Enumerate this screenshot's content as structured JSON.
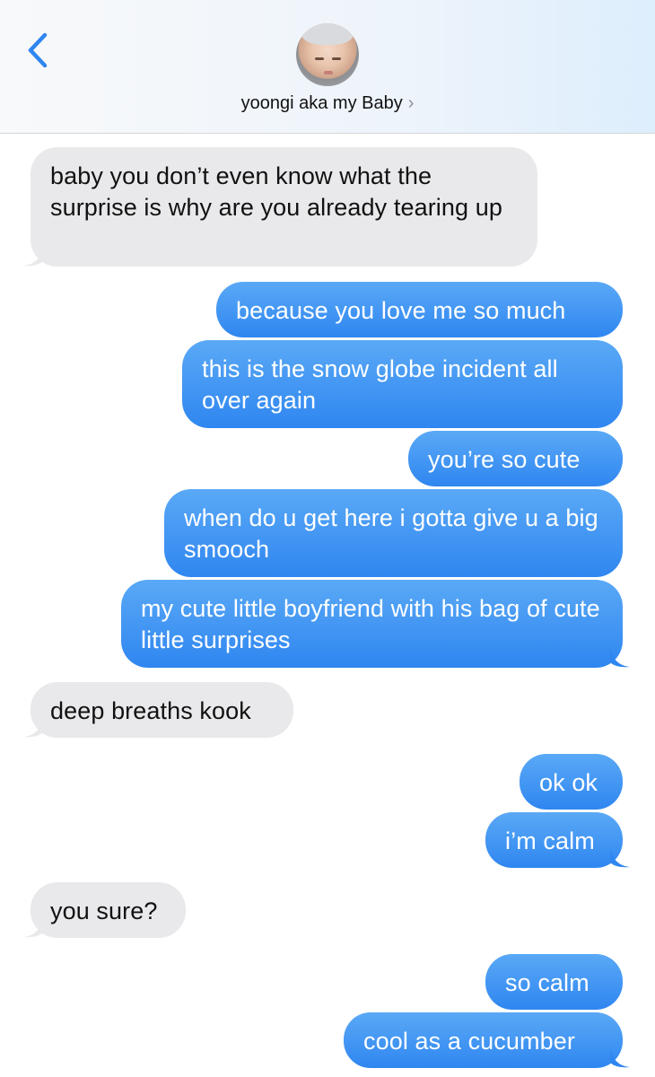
{
  "header": {
    "contact_name": "yoongi aka my Baby",
    "chevron": "›",
    "back_icon": "chevron-left-icon",
    "accent_color": "#2f86f0"
  },
  "messages": [
    {
      "direction": "received",
      "text": "baby you don’t even know what the surprise is why are you already tearing up"
    },
    {
      "direction": "sent",
      "text": "because you love me so much"
    },
    {
      "direction": "sent",
      "text": "this is the snow globe incident all over again"
    },
    {
      "direction": "sent",
      "text": "you’re so cute"
    },
    {
      "direction": "sent",
      "text": "when do u get here i gotta give u a big smooch"
    },
    {
      "direction": "sent",
      "text": "my cute little boyfriend with his bag of cute little surprises"
    },
    {
      "direction": "received",
      "text": "deep breaths kook"
    },
    {
      "direction": "sent",
      "text": "ok ok"
    },
    {
      "direction": "sent",
      "text": "i’m calm"
    },
    {
      "direction": "received",
      "text": "you sure?"
    },
    {
      "direction": "sent",
      "text": "so calm"
    },
    {
      "direction": "sent",
      "text": "cool as a cucumber"
    }
  ],
  "colors": {
    "sent_bubble": "#3a8ef2",
    "received_bubble": "#e9e9eb"
  }
}
